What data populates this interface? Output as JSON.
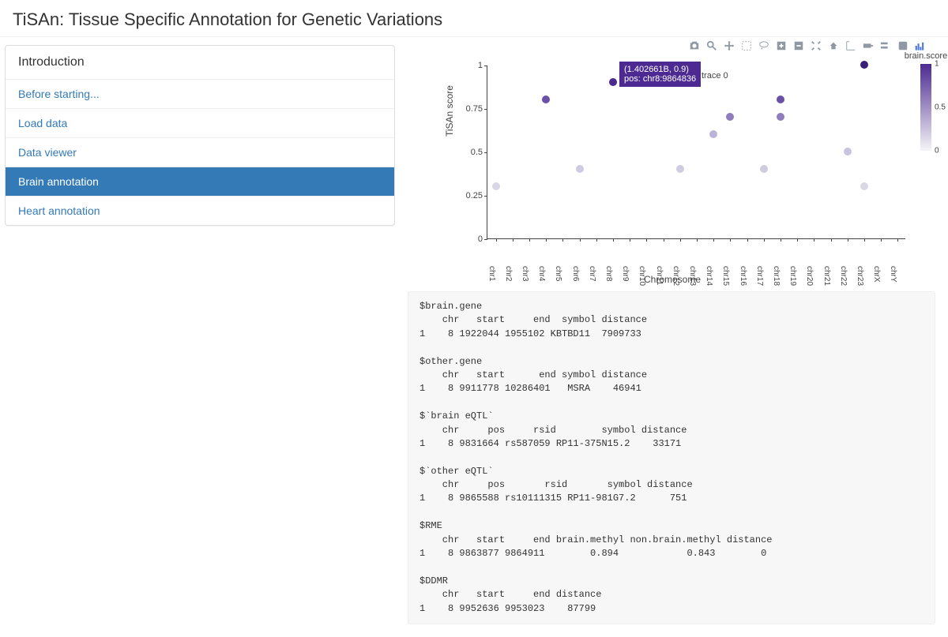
{
  "header": {
    "title": "TiSAn: Tissue Specific Annotation for Genetic Variations"
  },
  "sidebar": {
    "heading": "Introduction",
    "items": [
      {
        "label": "Before starting...",
        "active": false
      },
      {
        "label": "Load data",
        "active": false
      },
      {
        "label": "Data viewer",
        "active": false
      },
      {
        "label": "Brain annotation",
        "active": true
      },
      {
        "label": "Heart annotation",
        "active": false
      }
    ]
  },
  "toolbar_icons": [
    "camera-icon",
    "zoom-icon",
    "pan-icon",
    "box-select-icon",
    "lasso-select-icon",
    "zoom-in-icon",
    "zoom-out-icon",
    "autoscale-icon",
    "reset-axes-icon",
    "spike-lines-icon",
    "hover-closest-icon",
    "hover-compare-icon",
    "plotly-logo-icon",
    "bars-icon"
  ],
  "chart_data": {
    "type": "scatter",
    "xlabel": "Chromosome",
    "ylabel": "TiSAn score",
    "ylim": [
      0,
      1
    ],
    "yticks": [
      0,
      0.25,
      0.5,
      0.75,
      1
    ],
    "categories": [
      "chr1",
      "chr2",
      "chr3",
      "chr4",
      "chr5",
      "chr6",
      "chr7",
      "chr8",
      "chr9",
      "chr10",
      "chr11",
      "chr12",
      "chr13",
      "chr14",
      "chr15",
      "chr16",
      "chr17",
      "chr18",
      "chr19",
      "chr20",
      "chr21",
      "chr22",
      "chr23",
      "chrX",
      "chrY"
    ],
    "legend": {
      "title": "brain.score",
      "min": 0,
      "mid": 0.5,
      "max": 1
    },
    "points": [
      {
        "chr": "chr1",
        "score": 0.3,
        "color": "#d9d6e6"
      },
      {
        "chr": "chr4",
        "score": 0.8,
        "color": "#6b50a8"
      },
      {
        "chr": "chr6",
        "score": 0.4,
        "color": "#cfcbe1"
      },
      {
        "chr": "chr8",
        "score": 0.9,
        "color": "#4c2a92",
        "hovered": true,
        "hover_text": "(1.402661B, 0.9)",
        "hover_sub": "pos: chr8:9864836",
        "trace_label": "trace 0"
      },
      {
        "chr": "chr12",
        "score": 0.4,
        "color": "#cfcbe1"
      },
      {
        "chr": "chr14",
        "score": 0.6,
        "color": "#bcb4d8"
      },
      {
        "chr": "chr15",
        "score": 0.7,
        "color": "#927bbe"
      },
      {
        "chr": "chr17",
        "score": 0.4,
        "color": "#cfcbe1"
      },
      {
        "chr": "chr18",
        "score": 0.8,
        "color": "#6b50a8"
      },
      {
        "chr": "chr18",
        "score": 0.7,
        "color": "#927bbe"
      },
      {
        "chr": "chr22",
        "score": 0.5,
        "color": "#c9c3de"
      },
      {
        "chr": "chr23",
        "score": 1.0,
        "color": "#3a1f78"
      },
      {
        "chr": "chr23",
        "score": 0.3,
        "color": "#d9d6e6"
      }
    ]
  },
  "console_output": "$brain.gene\n    chr   start     end  symbol distance\n1    8 1922044 1955102 KBTBD11  7909733\n\n$other.gene\n    chr   start      end symbol distance\n1    8 9911778 10286401   MSRA    46941\n\n$`brain eQTL`\n    chr     pos     rsid        symbol distance\n1    8 9831664 rs587059 RP11-375N15.2    33171\n\n$`other eQTL`\n    chr     pos       rsid       symbol distance\n1    8 9865588 rs10111315 RP11-981G7.2      751\n\n$RME\n    chr   start     end brain.methyl non.brain.methyl distance\n1    8 9863877 9864911        0.894            0.843        0\n\n$DDMR\n    chr   start     end distance\n1    8 9952636 9953023    87799"
}
